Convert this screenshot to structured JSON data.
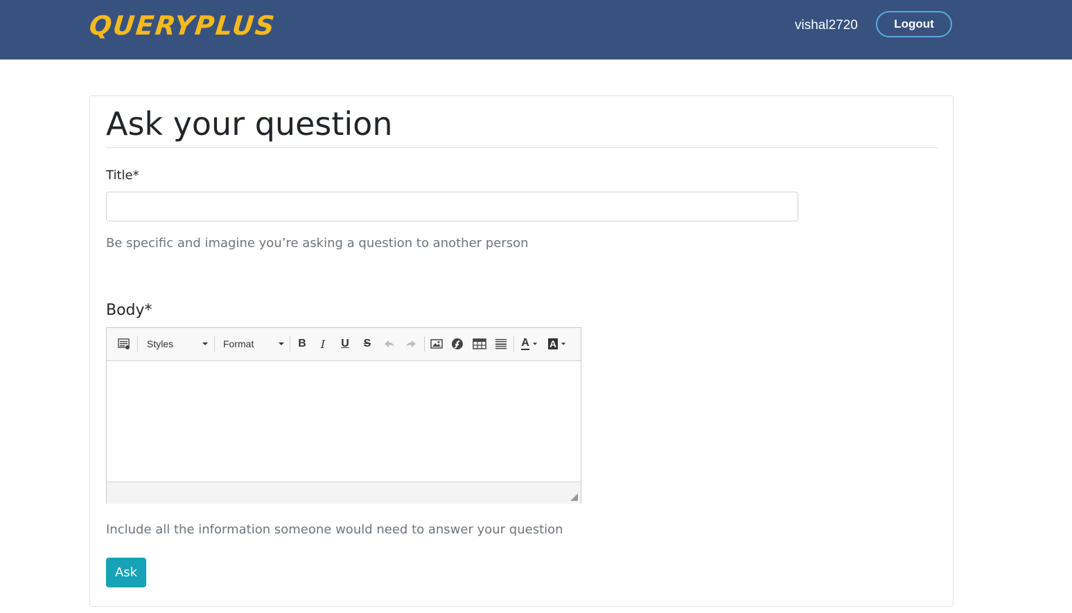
{
  "header": {
    "brand": "QUERYPLUS",
    "username": "vishal2720",
    "logout_label": "Logout",
    "brand_color": "#f6b91c",
    "bar_color": "#37527e"
  },
  "form": {
    "page_title": "Ask your question",
    "title_label": "Title*",
    "title_value": "",
    "title_help": "Be specific and imagine you’re asking a question to another person",
    "body_label": "Body*",
    "body_help": "Include all the information someone would need to answer your question",
    "submit_label": "Ask",
    "submit_color": "#17a2b8"
  },
  "editor": {
    "styles_label": "Styles",
    "format_label": "Format",
    "tools": [
      "source-icon",
      "bold-icon",
      "italic-icon",
      "underline-icon",
      "strikethrough-icon",
      "undo-icon",
      "redo-icon",
      "image-icon",
      "flash-icon",
      "table-icon",
      "horizontal-rule-icon",
      "text-color-icon",
      "background-color-icon"
    ],
    "bold_glyph": "B",
    "italic_glyph": "I",
    "underline_glyph": "U",
    "strike_glyph": "S",
    "color_glyph": "A"
  }
}
